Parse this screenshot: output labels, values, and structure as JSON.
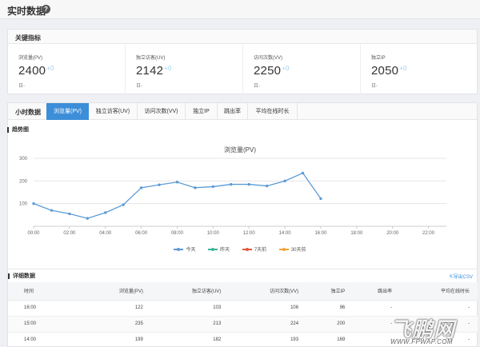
{
  "page": {
    "title": "实时数据",
    "help_icon": "?"
  },
  "kpi": {
    "heading": "关键指标",
    "items": [
      {
        "label": "浏览量(PV)",
        "value": "2400",
        "delta": "+0",
        "sub": "日-"
      },
      {
        "label": "独立访客(UV)",
        "value": "2142",
        "delta": "+0",
        "sub": "日-"
      },
      {
        "label": "访问次数(VV)",
        "value": "2250",
        "delta": "+0",
        "sub": "日-"
      },
      {
        "label": "独立IP",
        "value": "2050",
        "delta": "+0",
        "sub": "日-"
      }
    ]
  },
  "hourly": {
    "heading": "小时数据",
    "tabs": [
      "浏览量(PV)",
      "独立访客(UV)",
      "访问次数(VV)",
      "独立IP",
      "跳出率",
      "平均在线时长"
    ],
    "active_tab": 0
  },
  "trend": {
    "heading": "趋势图"
  },
  "chart_data": {
    "type": "line",
    "title": "浏览量(PV)",
    "x": [
      "00:00",
      "01:00",
      "02:00",
      "03:00",
      "04:00",
      "05:00",
      "06:00",
      "07:00",
      "08:00",
      "09:00",
      "10:00",
      "11:00",
      "12:00",
      "13:00",
      "14:00",
      "15:00",
      "16:00",
      "17:00",
      "18:00",
      "19:00",
      "20:00",
      "21:00",
      "22:00",
      "23:00"
    ],
    "x_tick_labels": [
      "00:00",
      "02:00",
      "04:00",
      "06:00",
      "08:00",
      "10:00",
      "12:00",
      "14:00",
      "16:00",
      "18:00",
      "20:00",
      "22:00"
    ],
    "y_ticks": [
      100,
      200,
      300
    ],
    "ylim": [
      0,
      300
    ],
    "series": [
      {
        "name": "今天",
        "color": "#5b9bd5",
        "values": [
          100,
          70,
          55,
          35,
          60,
          95,
          170,
          183,
          195,
          170,
          175,
          185,
          185,
          178,
          200,
          235,
          122
        ]
      }
    ],
    "legend": [
      {
        "name": "今天",
        "color": "#5b9bd5"
      },
      {
        "name": "昨天",
        "color": "#42b29a"
      },
      {
        "name": "7天前",
        "color": "#e4573d"
      },
      {
        "name": "30天前",
        "color": "#f0a33a"
      }
    ],
    "legend_position": "bottom",
    "grid": true
  },
  "detail": {
    "heading": "详细数据",
    "export_label": "导出CSV",
    "columns": [
      "时间",
      "浏览量(PV)",
      "独立访客(UV)",
      "访问次数(VV)",
      "独立IP",
      "跳出率",
      "平均在线时长"
    ],
    "rows": [
      [
        "16:00",
        "122",
        "103",
        "106",
        "96",
        "-",
        "-"
      ],
      [
        "15:00",
        "235",
        "213",
        "224",
        "200",
        "-",
        "-"
      ],
      [
        "14:00",
        "199",
        "182",
        "193",
        "169",
        "-",
        "-"
      ]
    ]
  },
  "watermark": {
    "text": "飞鹏网",
    "url": "WWW.FPWAP.COM"
  }
}
